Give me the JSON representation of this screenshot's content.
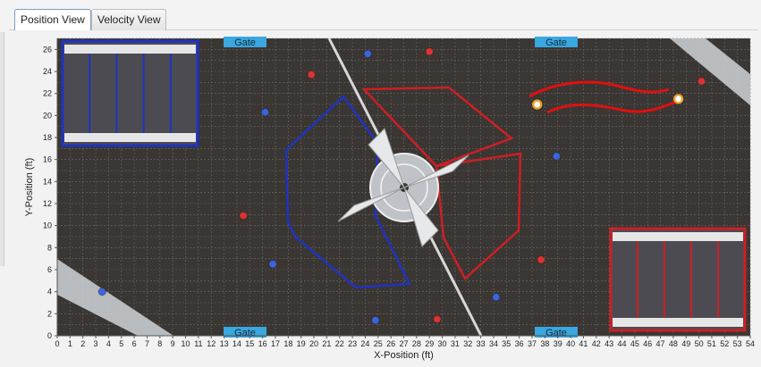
{
  "tabs": [
    {
      "label": "Position View",
      "active": true
    },
    {
      "label": "Velocity View",
      "active": false
    }
  ],
  "chart_data": {
    "type": "scatter",
    "title": "",
    "xlabel": "X-Position (ft)",
    "ylabel": "Y-Position (ft)",
    "xlim": [
      0,
      54
    ],
    "ylim": [
      0,
      27
    ],
    "x_ticks": [
      0,
      1,
      2,
      3,
      4,
      5,
      6,
      7,
      8,
      9,
      10,
      11,
      12,
      13,
      14,
      15,
      16,
      17,
      18,
      19,
      20,
      21,
      22,
      23,
      24,
      25,
      26,
      27,
      28,
      29,
      30,
      31,
      32,
      33,
      34,
      35,
      36,
      37,
      38,
      39,
      40,
      41,
      42,
      43,
      44,
      45,
      46,
      47,
      48,
      49,
      50,
      51,
      52,
      53,
      54
    ],
    "y_ticks": [
      0,
      2,
      4,
      6,
      8,
      10,
      12,
      14,
      16,
      18,
      20,
      22,
      24,
      26
    ],
    "grid": true,
    "field_labels": [
      "Gate",
      "Gate",
      "Gate",
      "Gate"
    ],
    "series": [
      {
        "color": "#3f64d8",
        "points": [
          [
            24.2,
            25.6
          ],
          [
            16.2,
            20.3
          ],
          [
            38.9,
            16.3
          ],
          [
            16.8,
            6.5
          ],
          [
            3.5,
            4.0
          ],
          [
            34.2,
            3.5
          ],
          [
            24.8,
            1.4
          ]
        ]
      },
      {
        "color": "#d83434",
        "points": [
          [
            29.0,
            25.8
          ],
          [
            19.8,
            23.7
          ],
          [
            50.2,
            23.1
          ],
          [
            14.5,
            10.9
          ],
          [
            37.7,
            6.9
          ],
          [
            29.6,
            1.5
          ]
        ]
      }
    ],
    "robot_markers": [
      {
        "color": "#f0a020",
        "point": [
          37.4,
          21.0
        ]
      },
      {
        "color": "#f0a020",
        "point": [
          48.4,
          21.5
        ]
      }
    ],
    "colors": {
      "field": "#3a3633",
      "grid": "#6d6966",
      "blue_zone": "#1f33c0",
      "red_zone": "#cc1f25",
      "gate_fill": "#39a7e0",
      "path": "#e01010"
    }
  }
}
